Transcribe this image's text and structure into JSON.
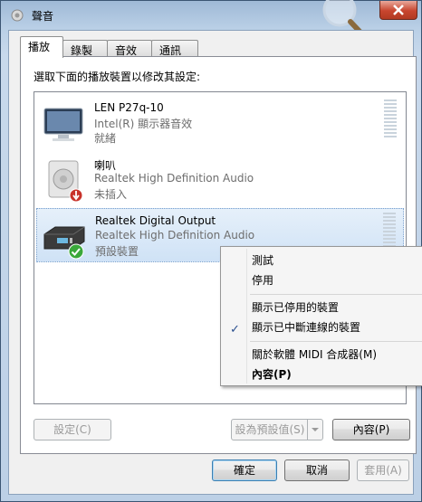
{
  "window": {
    "title": "聲音"
  },
  "tabs": [
    {
      "label": "播放"
    },
    {
      "label": "錄製"
    },
    {
      "label": "音效"
    },
    {
      "label": "通訊"
    }
  ],
  "instruction": "選取下面的播放裝置以修改其設定:",
  "devices": [
    {
      "name": "LEN P27q-10",
      "line1": "Intel(R) 顯示器音效",
      "line2": "就緒",
      "icon": "monitor-icon"
    },
    {
      "name": "喇叭",
      "line1": "Realtek High Definition Audio",
      "line2": "未插入",
      "icon": "speaker-icon",
      "status_icon": "unplugged-icon"
    },
    {
      "name": "Realtek Digital Output",
      "line1": "Realtek High Definition Audio",
      "line2": "預設裝置",
      "icon": "digital-output-icon",
      "status_icon": "default-check-icon"
    }
  ],
  "buttons": {
    "configure": "設定(C)",
    "set_default": "設為預設值(S)",
    "properties": "內容(P)",
    "ok": "確定",
    "cancel": "取消",
    "apply": "套用(A)"
  },
  "context_menu": {
    "items": [
      {
        "label": "測試"
      },
      {
        "label": "停用"
      },
      {
        "label": "顯示已停用的裝置"
      },
      {
        "label": "顯示已中斷連線的裝置",
        "checked": true
      },
      {
        "label": "關於軟體 MIDI 合成器(M)"
      },
      {
        "label": "內容(P)",
        "bold": true
      }
    ]
  },
  "colors": {
    "selection": "#cfe2f6",
    "check_green": "#3aa83a",
    "unplug_red": "#c8322a"
  }
}
